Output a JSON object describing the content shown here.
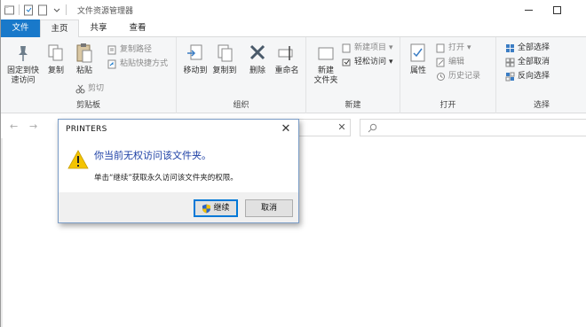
{
  "window": {
    "title": "文件资源管理器"
  },
  "tabs": {
    "file": "文件",
    "home": "主页",
    "share": "共享",
    "view": "查看"
  },
  "ribbon": {
    "clipboard": {
      "pin": "固定到快\n速访问",
      "pin_l1": "固定到快",
      "pin_l2": "速访问",
      "copy": "复制",
      "paste": "粘贴",
      "copy_path": "复制路径",
      "paste_shortcut": "粘贴快捷方式",
      "cut": "剪切",
      "label": "剪贴板"
    },
    "organize": {
      "move_to": "移动到",
      "copy_to": "复制到",
      "delete": "删除",
      "rename": "重命名",
      "label": "组织"
    },
    "new": {
      "new_folder_l1": "新建",
      "new_folder_l2": "文件夹",
      "new_item": "新建项目",
      "easy_access": "轻松访问",
      "label": "新建"
    },
    "open": {
      "properties": "属性",
      "open": "打开",
      "edit": "编辑",
      "history": "历史记录",
      "label": "打开"
    },
    "select": {
      "select_all": "全部选择",
      "select_none": "全部取消",
      "invert": "反向选择",
      "label": "选择"
    }
  },
  "dialog": {
    "title": "PRINTERS",
    "main_text": "你当前无权访问该文件夹。",
    "sub_text": "单击“继续”获取永久访问该文件夹的权限。",
    "continue_label": "继续",
    "cancel_label": "取消"
  },
  "colors": {
    "file_tab": "#1979ca",
    "dialog_main_text": "#1c3fa5",
    "warning": "#f4c400"
  }
}
